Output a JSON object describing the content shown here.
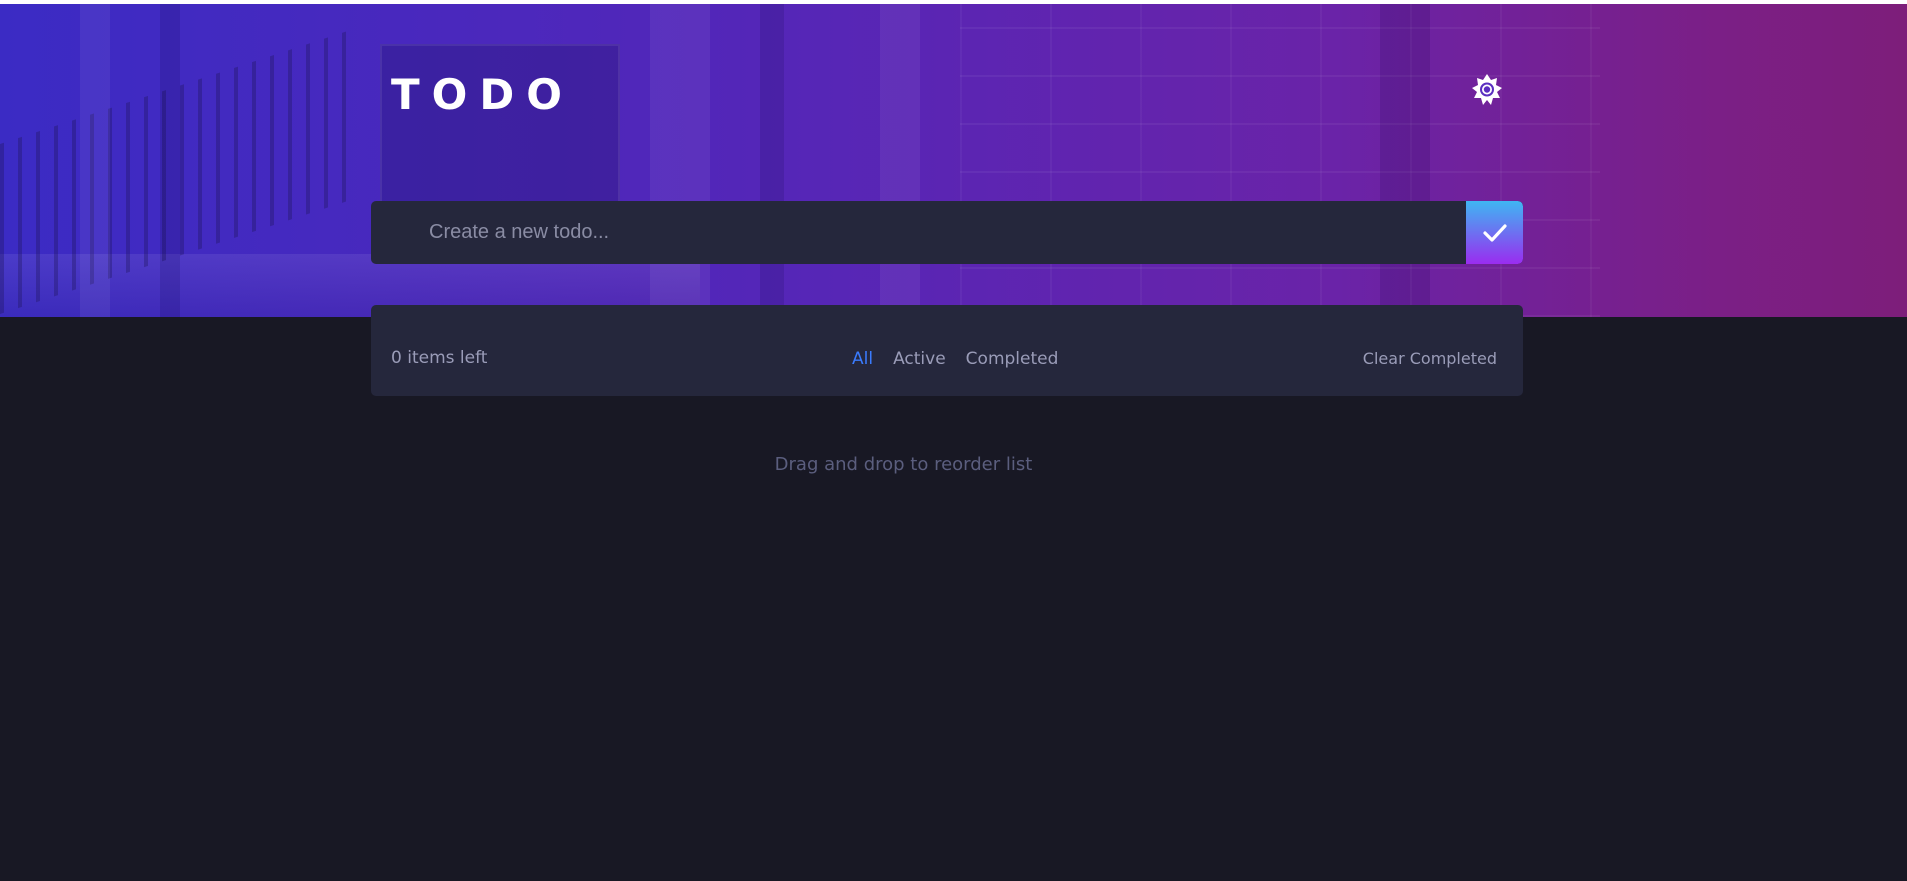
{
  "header": {
    "title": "TODO",
    "theme_icon": "sun-icon"
  },
  "new_todo": {
    "placeholder": "Create a new todo...",
    "value": "",
    "submit_icon": "check-icon"
  },
  "footer": {
    "items_left": "0 items left",
    "filters": [
      {
        "label": "All",
        "active": true
      },
      {
        "label": "Active",
        "active": false
      },
      {
        "label": "Completed",
        "active": false
      }
    ],
    "clear_label": "Clear Completed"
  },
  "hint": "Drag and drop to reorder list",
  "colors": {
    "background": "#181824",
    "card": "#25273c",
    "accent": "#3a7bfd",
    "gradient_start": "#3fb6f2",
    "gradient_end": "#9a2cf0"
  }
}
